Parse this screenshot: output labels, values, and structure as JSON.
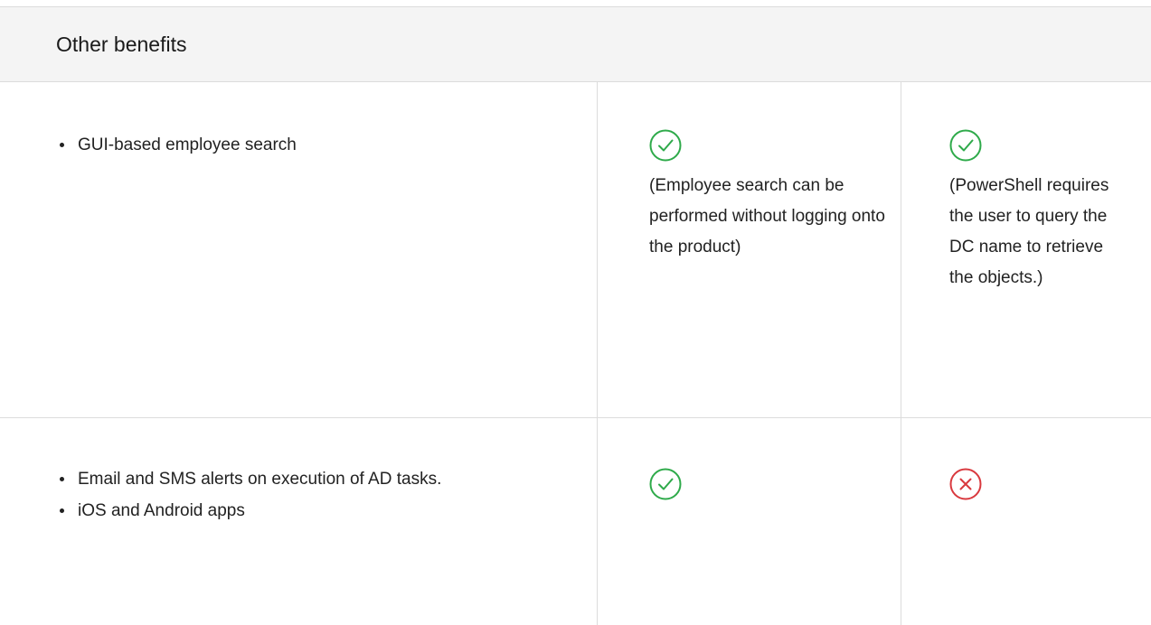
{
  "section": {
    "title": "Other benefits"
  },
  "colors": {
    "check": "#2eaa4a",
    "cross": "#d9393e",
    "border": "#dcdcdc",
    "header_bg": "#f4f4f4"
  },
  "rows": [
    {
      "features": [
        "GUI-based employee search"
      ],
      "product": {
        "status": "check-circle-icon",
        "note": "(Employee search can be performed without logging onto the product)"
      },
      "powershell": {
        "status": "check-circle-icon",
        "note": "(PowerShell requires the user to query the DC name to retrieve the objects.)"
      }
    },
    {
      "features": [
        "Email and SMS alerts on execution of AD tasks.",
        "iOS and Android apps"
      ],
      "product": {
        "status": "check-circle-icon",
        "note": ""
      },
      "powershell": {
        "status": "cross-circle-icon",
        "note": ""
      }
    }
  ]
}
